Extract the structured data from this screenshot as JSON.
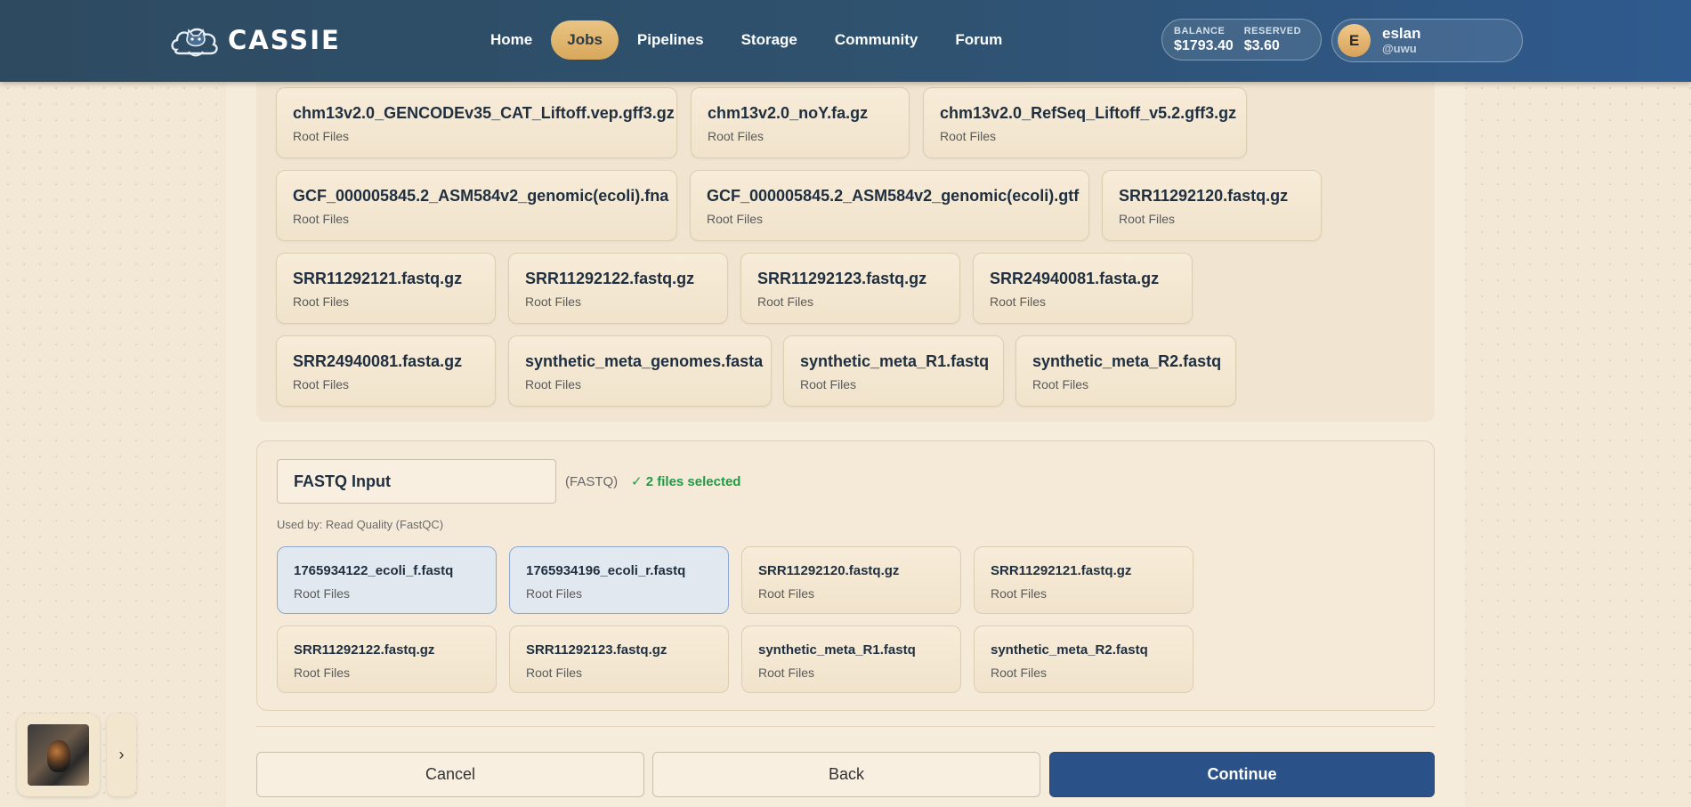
{
  "header": {
    "brand": "CASSIE",
    "nav": [
      {
        "label": "Home",
        "active": false
      },
      {
        "label": "Jobs",
        "active": true
      },
      {
        "label": "Pipelines",
        "active": false
      },
      {
        "label": "Storage",
        "active": false
      },
      {
        "label": "Community",
        "active": false
      },
      {
        "label": "Forum",
        "active": false
      }
    ],
    "balance": {
      "label": "BALANCE",
      "value": "$1793.40"
    },
    "reserved": {
      "label": "RESERVED",
      "value": "$3.60"
    },
    "user": {
      "initial": "E",
      "name": "eslan",
      "handle": "@uwu"
    }
  },
  "file_rows": [
    [
      {
        "name": "chm13v2.0_GENCODEv35_CAT_Liftoff.vep.gff3.gz",
        "location": "Root Files"
      },
      {
        "name": "chm13v2.0_noY.fa.gz",
        "location": "Root Files"
      },
      {
        "name": "chm13v2.0_RefSeq_Liftoff_v5.2.gff3.gz",
        "location": "Root Files"
      }
    ],
    [
      {
        "name": "GCF_000005845.2_ASM584v2_genomic(ecoli).fna",
        "location": "Root Files"
      },
      {
        "name": "GCF_000005845.2_ASM584v2_genomic(ecoli).gtf",
        "location": "Root Files"
      },
      {
        "name": "SRR11292120.fastq.gz",
        "location": "Root Files"
      }
    ],
    [
      {
        "name": "SRR11292121.fastq.gz",
        "location": "Root Files"
      },
      {
        "name": "SRR11292122.fastq.gz",
        "location": "Root Files"
      },
      {
        "name": "SRR11292123.fastq.gz",
        "location": "Root Files"
      },
      {
        "name": "SRR24940081.fasta.gz",
        "location": "Root Files"
      }
    ],
    [
      {
        "name": "SRR24940081.fasta.gz",
        "location": "Root Files"
      },
      {
        "name": "synthetic_meta_genomes.fasta",
        "location": "Root Files"
      },
      {
        "name": "synthetic_meta_R1.fastq",
        "location": "Root Files"
      },
      {
        "name": "synthetic_meta_R2.fastq",
        "location": "Root Files"
      }
    ]
  ],
  "fastq": {
    "input_value": "FASTQ Input",
    "type": "(FASTQ)",
    "selected_text": "✓ 2 files selected",
    "used_by": "Used by: Read Quality (FastQC)",
    "files": [
      {
        "name": "1765934122_ecoli_f.fastq",
        "location": "Root Files",
        "selected": true
      },
      {
        "name": "1765934196_ecoli_r.fastq",
        "location": "Root Files",
        "selected": true
      },
      {
        "name": "SRR11292120.fastq.gz",
        "location": "Root Files",
        "selected": false
      },
      {
        "name": "SRR11292121.fastq.gz",
        "location": "Root Files",
        "selected": false
      },
      {
        "name": "SRR11292122.fastq.gz",
        "location": "Root Files",
        "selected": false
      },
      {
        "name": "SRR11292123.fastq.gz",
        "location": "Root Files",
        "selected": false
      },
      {
        "name": "synthetic_meta_R1.fastq",
        "location": "Root Files",
        "selected": false
      },
      {
        "name": "synthetic_meta_R2.fastq",
        "location": "Root Files",
        "selected": false
      }
    ]
  },
  "actions": {
    "cancel": "Cancel",
    "back": "Back",
    "continue": "Continue"
  },
  "widget": {
    "expand_icon": "›"
  },
  "colors": {
    "header": "#2f5270",
    "accent": "#d8a85c",
    "primary": "#2a5288",
    "success": "#1f9b46"
  }
}
